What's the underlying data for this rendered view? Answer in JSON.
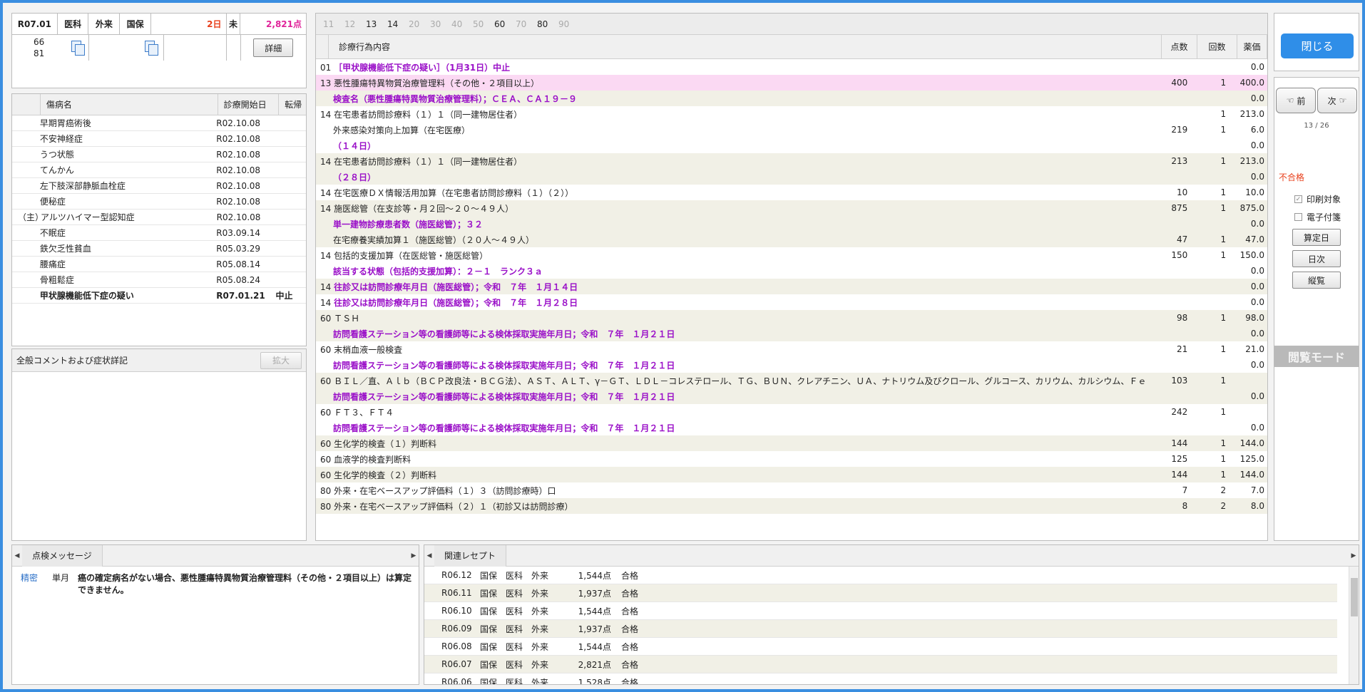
{
  "summary": {
    "date": "R07.01",
    "dept": "医科",
    "visit": "外来",
    "insurance": "国保",
    "days": "2日",
    "flag": "未",
    "points": "2,821点",
    "num1": "66",
    "num2": "81",
    "detail_label": "詳細"
  },
  "disease_table": {
    "headers": [
      "傷病名",
      "診療開始日",
      "転帰"
    ],
    "rows": [
      {
        "mark": "",
        "name": "早期胃癌術後",
        "date": "R02.10.08",
        "outcome": ""
      },
      {
        "mark": "",
        "name": "不安神経症",
        "date": "R02.10.08",
        "outcome": ""
      },
      {
        "mark": "",
        "name": "うつ状態",
        "date": "R02.10.08",
        "outcome": ""
      },
      {
        "mark": "",
        "name": "てんかん",
        "date": "R02.10.08",
        "outcome": ""
      },
      {
        "mark": "",
        "name": "左下肢深部静脈血栓症",
        "date": "R02.10.08",
        "outcome": ""
      },
      {
        "mark": "",
        "name": "便秘症",
        "date": "R02.10.08",
        "outcome": ""
      },
      {
        "mark": "（主）",
        "name": "アルツハイマー型認知症",
        "date": "R02.10.08",
        "outcome": ""
      },
      {
        "mark": "",
        "name": "不眠症",
        "date": "R03.09.14",
        "outcome": ""
      },
      {
        "mark": "",
        "name": "鉄欠乏性貧血",
        "date": "R05.03.29",
        "outcome": ""
      },
      {
        "mark": "",
        "name": "腰痛症",
        "date": "R05.08.14",
        "outcome": ""
      },
      {
        "mark": "",
        "name": "骨粗鬆症",
        "date": "R05.08.24",
        "outcome": ""
      },
      {
        "mark": "",
        "name": "甲状腺機能低下症の疑い",
        "date": "R07.01.21",
        "outcome": "中止"
      }
    ]
  },
  "comment_panel": {
    "title": "全般コメントおよび症状詳記",
    "expand_label": "拡大"
  },
  "main": {
    "tabs": [
      {
        "label": "11",
        "active": false
      },
      {
        "label": "12",
        "active": false
      },
      {
        "label": "13",
        "active": true
      },
      {
        "label": "14",
        "active": true
      },
      {
        "label": "20",
        "active": false
      },
      {
        "label": "30",
        "active": false
      },
      {
        "label": "40",
        "active": false
      },
      {
        "label": "50",
        "active": false
      },
      {
        "label": "60",
        "active": true
      },
      {
        "label": "70",
        "active": false
      },
      {
        "label": "80",
        "active": true
      },
      {
        "label": "90",
        "active": false
      }
    ],
    "headers": {
      "content": "診療行為内容",
      "points": "点数",
      "count": "回数",
      "price": "薬価"
    },
    "rows": [
      {
        "text": "01 ［甲状腺機能低下症の疑い］（1月31日）中止",
        "style": "purple-tail",
        "prefix": "01 ",
        "body": "［甲状腺機能低下症の疑い］（1月31日）中止",
        "points": "",
        "count": "",
        "price": "0.0",
        "bg": ""
      },
      {
        "prefix": "13 ",
        "body": "悪性腫瘍特異物質治療管理料（その他・２項目以上）",
        "points": "400",
        "count": "1",
        "price": "400.0",
        "bg": "hl",
        "purple": false
      },
      {
        "prefix": "",
        "body": "検査名（悪性腫瘍特異物質治療管理料）；ＣＥＡ、ＣＡ１９－９",
        "points": "",
        "count": "",
        "price": "0.0",
        "bg": "alt",
        "purple": true,
        "indent": true
      },
      {
        "prefix": "14 ",
        "body": "在宅患者訪問診療料（１）１（同一建物居住者）",
        "points": "",
        "count": "1",
        "price": "213.0",
        "bg": "",
        "purple": false
      },
      {
        "prefix": "",
        "body": "外来感染対策向上加算（在宅医療）",
        "points": "219",
        "count": "1",
        "price": "6.0",
        "bg": "",
        "purple": false,
        "indent": true
      },
      {
        "prefix": "",
        "body": "（１４日）",
        "points": "",
        "count": "",
        "price": "0.0",
        "bg": "",
        "purple": true,
        "indent": true
      },
      {
        "prefix": "14 ",
        "body": "在宅患者訪問診療料（１）１（同一建物居住者）",
        "points": "213",
        "count": "1",
        "price": "213.0",
        "bg": "alt",
        "purple": false
      },
      {
        "prefix": "",
        "body": "（２８日）",
        "points": "",
        "count": "",
        "price": "0.0",
        "bg": "alt",
        "purple": true,
        "indent": true
      },
      {
        "prefix": "14 ",
        "body": "在宅医療ＤＸ情報活用加算（在宅患者訪問診療料（１）（２））",
        "points": "10",
        "count": "1",
        "price": "10.0",
        "bg": "",
        "purple": false
      },
      {
        "prefix": "14 ",
        "body": "施医総管（在支診等・月２回～２０～４９人）",
        "points": "875",
        "count": "1",
        "price": "875.0",
        "bg": "alt",
        "purple": false
      },
      {
        "prefix": "",
        "body": "単一建物診療患者数（施医総管）；３２",
        "points": "",
        "count": "",
        "price": "0.0",
        "bg": "alt",
        "purple": true,
        "indent": true
      },
      {
        "prefix": "",
        "body": "在宅療養実績加算１（施医総管）（２０人～４９人）",
        "points": "47",
        "count": "1",
        "price": "47.0",
        "bg": "alt",
        "purple": false,
        "indent": true
      },
      {
        "prefix": "14 ",
        "body": "包括的支援加算（在医総管・施医総管）",
        "points": "150",
        "count": "1",
        "price": "150.0",
        "bg": "",
        "purple": false
      },
      {
        "prefix": "",
        "body": "該当する状態（包括的支援加算）：２－１　ランク３ａ",
        "points": "",
        "count": "",
        "price": "0.0",
        "bg": "",
        "purple": true,
        "indent": true
      },
      {
        "prefix": "14 ",
        "body": "往診又は訪問診療年月日（施医総管）；令和　７年　１月１４日",
        "points": "",
        "count": "",
        "price": "0.0",
        "bg": "alt",
        "purple": true
      },
      {
        "prefix": "14 ",
        "body": "往診又は訪問診療年月日（施医総管）；令和　７年　１月２８日",
        "points": "",
        "count": "",
        "price": "0.0",
        "bg": "",
        "purple": true
      },
      {
        "prefix": "60 ",
        "body": "ＴＳＨ",
        "points": "98",
        "count": "1",
        "price": "98.0",
        "bg": "alt",
        "purple": false
      },
      {
        "prefix": "",
        "body": "訪問看護ステーション等の看護師等による検体採取実施年月日；令和　７年　１月２１日",
        "points": "",
        "count": "",
        "price": "0.0",
        "bg": "alt",
        "purple": true,
        "indent": true
      },
      {
        "prefix": "60 ",
        "body": "末梢血液一般検査",
        "points": "21",
        "count": "1",
        "price": "21.0",
        "bg": "",
        "purple": false
      },
      {
        "prefix": "",
        "body": "訪問看護ステーション等の看護師等による検体採取実施年月日；令和　７年　１月２１日",
        "points": "",
        "count": "",
        "price": "0.0",
        "bg": "",
        "purple": true,
        "indent": true
      },
      {
        "prefix": "60 ",
        "body": "ＢＩＬ／直、Ａｌｂ（ＢＣＰ改良法・ＢＣＧ法）、ＡＳＴ、ＡＬＴ、γ－ＧＴ、ＬＤＬ－コレステロール、ＴＧ、ＢＵＮ、クレアチニン、ＵＡ、ナトリウム及びクロール、グルコース、カリウム、カルシウム、Ｆｅ",
        "points": "103",
        "count": "1",
        "price": "",
        "bg": "alt",
        "purple": false
      },
      {
        "prefix": "",
        "body": "訪問看護ステーション等の看護師等による検体採取実施年月日；令和　７年　１月２１日",
        "points": "",
        "count": "",
        "price": "0.0",
        "bg": "alt",
        "purple": true,
        "indent": true
      },
      {
        "prefix": "60 ",
        "body": "ＦＴ３、ＦＴ４",
        "points": "242",
        "count": "1",
        "price": "",
        "bg": "",
        "purple": false
      },
      {
        "prefix": "",
        "body": "訪問看護ステーション等の看護師等による検体採取実施年月日；令和　７年　１月２１日",
        "points": "",
        "count": "",
        "price": "0.0",
        "bg": "",
        "purple": true,
        "indent": true
      },
      {
        "prefix": "60 ",
        "body": "生化学的検査（１）判断料",
        "points": "144",
        "count": "1",
        "price": "144.0",
        "bg": "alt",
        "purple": false
      },
      {
        "prefix": "60 ",
        "body": "血液学的検査判断料",
        "points": "125",
        "count": "1",
        "price": "125.0",
        "bg": "",
        "purple": false
      },
      {
        "prefix": "60 ",
        "body": "生化学的検査（２）判断料",
        "points": "144",
        "count": "1",
        "price": "144.0",
        "bg": "alt",
        "purple": false
      },
      {
        "prefix": "80 ",
        "body": "外来・在宅ベースアップ評価料（１）３（訪問診療時）口",
        "points": "7",
        "count": "2",
        "price": "7.0",
        "bg": "",
        "purple": false
      },
      {
        "prefix": "80 ",
        "body": "外来・在宅ベースアップ評価料（２）１（初診又は訪問診療）",
        "points": "8",
        "count": "2",
        "price": "8.0",
        "bg": "alt",
        "purple": false
      }
    ]
  },
  "right_panel": {
    "close_label": "閉じる",
    "prev_label": "前",
    "next_label": "次",
    "page_indicator": "13 / 26",
    "status": "不合格",
    "print_target": "印刷対象",
    "electronic": "電子付箋",
    "calc_day": "算定日",
    "day_order": "日次",
    "overview": "縦覧",
    "mode": "閲覧モード",
    "status_color": "#e8401c"
  },
  "check_messages": {
    "tab_label": "点検メッセージ",
    "items": [
      {
        "type": "精密",
        "period": "単月",
        "message": "癌の確定病名がない場合、悪性腫瘍特異物質治療管理料（その他・２項目以上）は算定できません。"
      }
    ]
  },
  "related": {
    "tab_label": "関連レセプト",
    "rows": [
      {
        "date": "R06.12",
        "ins": "国保",
        "dept": "医科",
        "visit": "外来",
        "points": "1,544点",
        "result": "合格"
      },
      {
        "date": "R06.11",
        "ins": "国保",
        "dept": "医科",
        "visit": "外来",
        "points": "1,937点",
        "result": "合格"
      },
      {
        "date": "R06.10",
        "ins": "国保",
        "dept": "医科",
        "visit": "外来",
        "points": "1,544点",
        "result": "合格"
      },
      {
        "date": "R06.09",
        "ins": "国保",
        "dept": "医科",
        "visit": "外来",
        "points": "1,937点",
        "result": "合格"
      },
      {
        "date": "R06.08",
        "ins": "国保",
        "dept": "医科",
        "visit": "外来",
        "points": "1,544点",
        "result": "合格"
      },
      {
        "date": "R06.07",
        "ins": "国保",
        "dept": "医科",
        "visit": "外来",
        "points": "2,821点",
        "result": "合格"
      },
      {
        "date": "R06.06",
        "ins": "国保",
        "dept": "医科",
        "visit": "外来",
        "points": "1,528点",
        "result": "合格"
      }
    ]
  }
}
